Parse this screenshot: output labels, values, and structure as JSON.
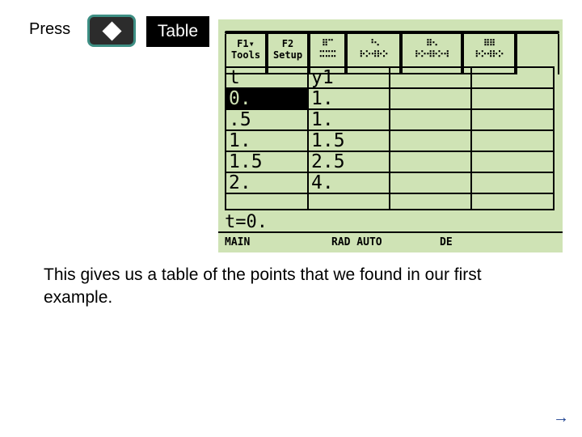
{
  "instruction": {
    "press_label": "Press",
    "diamond_key": "diamond",
    "table_key_label": "Table"
  },
  "calculator": {
    "toolbar": {
      "tabs": [
        {
          "key": "F1▾",
          "name": "Tools"
        },
        {
          "key": "F2",
          "name": "Setup"
        },
        {
          "key": "",
          "name": ""
        },
        {
          "key": "",
          "name": ""
        },
        {
          "key": "",
          "name": ""
        },
        {
          "key": "",
          "name": ""
        },
        {
          "key": "",
          "name": ""
        }
      ]
    },
    "table": {
      "headers": [
        "t",
        "y1",
        "",
        "",
        ""
      ],
      "rows": [
        [
          "0.",
          "1.",
          "",
          "",
          ""
        ],
        [
          ".5",
          "1.",
          "",
          "",
          ""
        ],
        [
          "1.",
          "1.5",
          "",
          "",
          ""
        ],
        [
          "1.5",
          "2.5",
          "",
          "",
          ""
        ],
        [
          "2.",
          "4.",
          "",
          "",
          ""
        ],
        [
          "",
          "",
          "",
          "",
          ""
        ]
      ],
      "selected_cell": "0."
    },
    "entry_line": "t=0.",
    "status": {
      "folder": "MAIN",
      "angle_mode": "RAD AUTO",
      "graph_mode": "DE"
    }
  },
  "caption": "This gives us a table of the points that we found in our first example.",
  "next_arrow": "→",
  "colors": {
    "screen_bg": "#cfe3b5",
    "key_border": "#3e8f84",
    "arrow": "#1a3f8f"
  }
}
